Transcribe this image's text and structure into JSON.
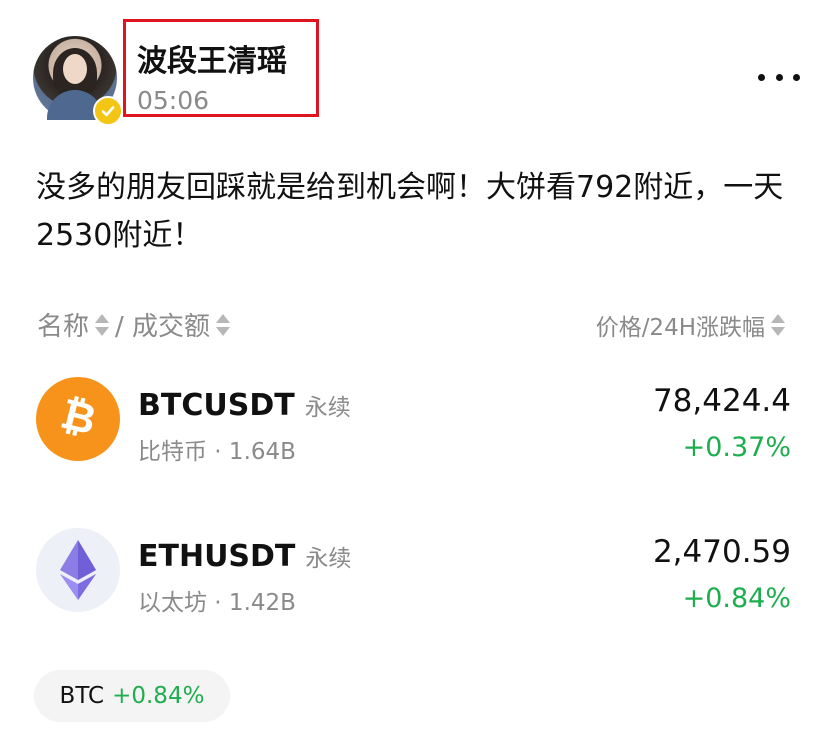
{
  "header": {
    "author_name": "波段王清瑶",
    "time": "05:06"
  },
  "post": {
    "text": "没多的朋友回踩就是给到机会啊！大饼看792附近，一天2530附近！"
  },
  "market": {
    "header_left": {
      "name_label": "名称",
      "volume_label": "/ 成交额"
    },
    "header_right": {
      "price_change_label": "价格/24H涨跌幅"
    },
    "coins": [
      {
        "symbol": "BTCUSDT",
        "tag": "永续",
        "name_volume": "比特币 · 1.64B",
        "price": "78,424.4",
        "change": "+0.37%"
      },
      {
        "symbol": "ETHUSDT",
        "tag": "永续",
        "name_volume": "以太坊 · 1.42B",
        "price": "2,470.59",
        "change": "+0.84%"
      }
    ]
  },
  "ticker_chip": {
    "symbol": "BTC",
    "change": "+0.84%"
  },
  "colors": {
    "positive": "#1ead4f",
    "secondary_text": "#8a8a8a",
    "highlight_box": "#e0141e",
    "btc_orange": "#f7931a",
    "verified_yellow": "#f3c515"
  },
  "icons": {
    "avatar": "user-avatar",
    "verified": "verified-badge-icon",
    "more": "more-horizontal-icon",
    "sort": "sort-icon",
    "btc": "bitcoin-icon",
    "eth": "ethereum-icon"
  }
}
